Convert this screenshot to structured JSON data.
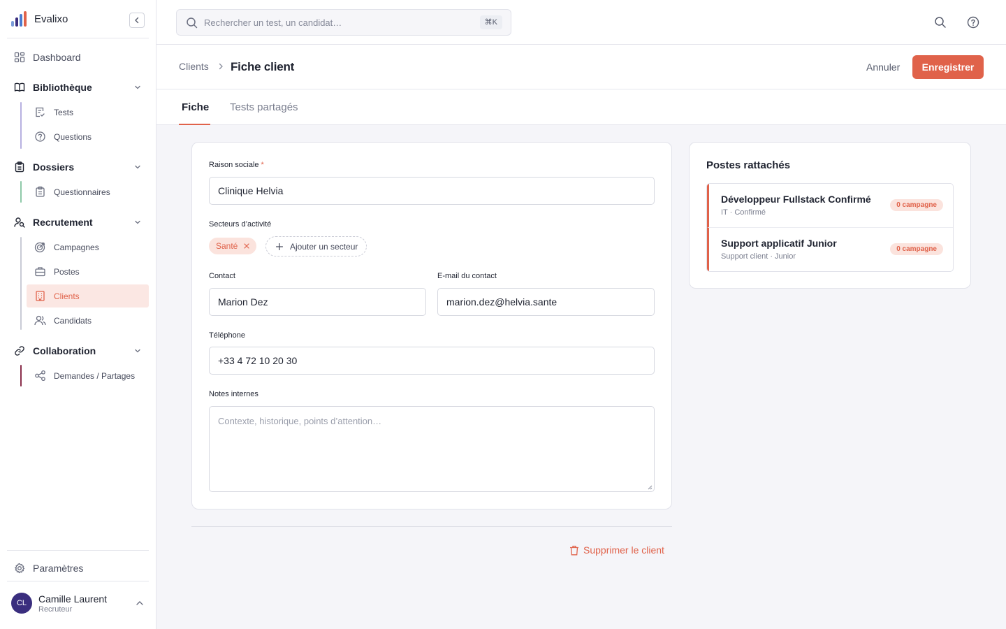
{
  "app": {
    "name": "Evalixo"
  },
  "sidebar": {
    "dashboard": "Dashboard",
    "groups": [
      {
        "label": "Bibliothèque",
        "items": [
          {
            "label": "Tests"
          },
          {
            "label": "Questions"
          }
        ]
      },
      {
        "label": "Dossiers",
        "items": [
          {
            "label": "Questionnaires"
          }
        ]
      },
      {
        "label": "Recrutement",
        "items": [
          {
            "label": "Campagnes"
          },
          {
            "label": "Postes"
          },
          {
            "label": "Clients"
          },
          {
            "label": "Candidats"
          }
        ]
      },
      {
        "label": "Collaboration",
        "items": [
          {
            "label": "Demandes / Partages"
          }
        ]
      }
    ],
    "settings": "Paramètres",
    "user": {
      "initials": "CL",
      "name": "Camille Laurent",
      "role": "Recruteur"
    }
  },
  "topbar": {
    "search_placeholder": "Rechercher un test, un candidat…",
    "shortcut": "⌘K"
  },
  "header": {
    "breadcrumb_parent": "Clients",
    "title": "Fiche client",
    "cancel_label": "Annuler",
    "save_label": "Enregistrer"
  },
  "tabs": [
    {
      "label": "Fiche",
      "active": true
    },
    {
      "label": "Tests partagés",
      "active": false
    }
  ],
  "form": {
    "raison_sociale": {
      "label": "Raison sociale",
      "required_mark": "*",
      "value": "Clinique Helvia"
    },
    "secteurs": {
      "label": "Secteurs d’activité",
      "chips": [
        "Santé"
      ],
      "add_label": "Ajouter un secteur"
    },
    "contact": {
      "label": "Contact",
      "value": "Marion Dez"
    },
    "email": {
      "label": "E-mail du contact",
      "value": "marion.dez@helvia.sante"
    },
    "telephone": {
      "label": "Téléphone",
      "value": "+33 4 72 10 20 30"
    },
    "notes": {
      "label": "Notes internes",
      "placeholder": "Contexte, historique, points d’attention…"
    },
    "delete_label": "Supprimer le client"
  },
  "postes": {
    "title": "Postes rattachés",
    "items": [
      {
        "title": "Développeur Fullstack Confirmé",
        "subtitle": "IT · Confirmé",
        "badge": "0 campagne"
      },
      {
        "title": "Support applicatif Junior",
        "subtitle": "Support client · Junior",
        "badge": "0 campagne"
      }
    ]
  },
  "colors": {
    "accent": "#e0624a",
    "avatar": "#3a2e7e"
  }
}
